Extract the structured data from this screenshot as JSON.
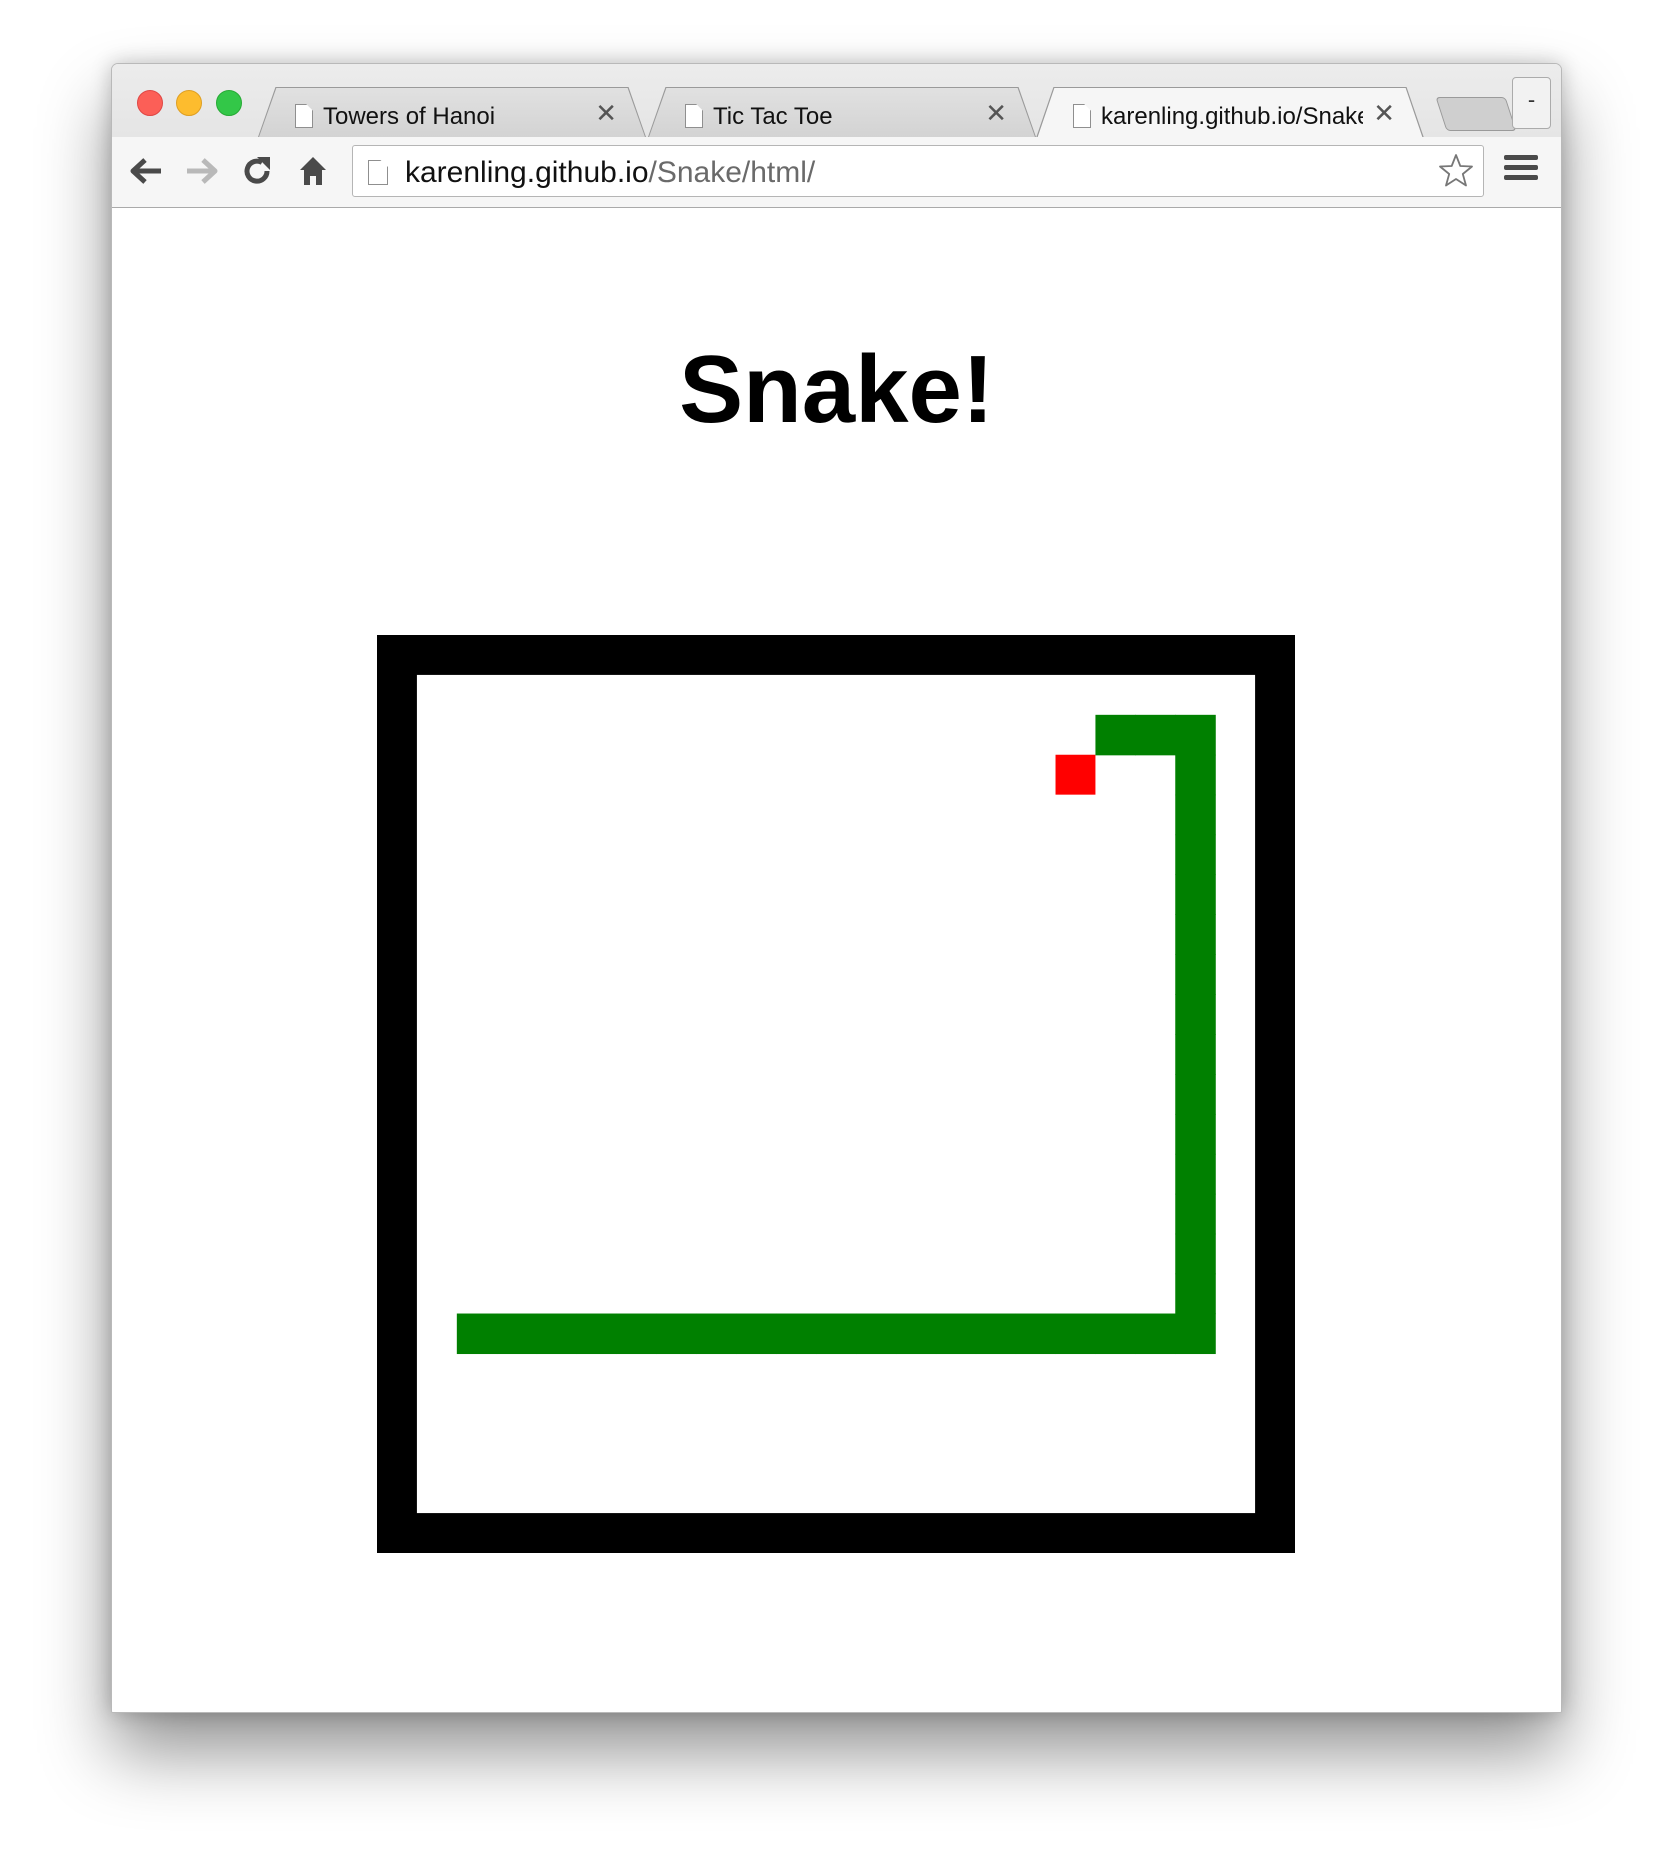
{
  "browser": {
    "tabs": [
      {
        "label": "Towers of Hanoi",
        "active": false
      },
      {
        "label": "Tic Tac Toe",
        "active": false
      },
      {
        "label": "karenling.github.io/Snake/html/",
        "active": true
      }
    ],
    "profile_label": "-",
    "address": {
      "host": "karenling.github.io",
      "path": "/Snake/html/"
    }
  },
  "page": {
    "heading": "Snake!"
  },
  "game": {
    "grid_size": 21,
    "colors": {
      "wall": "#000000",
      "snake": "#008000",
      "apple": "#ff0000",
      "floor": "#ffffff"
    },
    "snake_cells": [
      [
        1,
        16
      ],
      [
        2,
        16
      ],
      [
        3,
        16
      ],
      [
        4,
        16
      ],
      [
        5,
        16
      ],
      [
        6,
        16
      ],
      [
        7,
        16
      ],
      [
        8,
        16
      ],
      [
        9,
        16
      ],
      [
        10,
        16
      ],
      [
        11,
        16
      ],
      [
        12,
        16
      ],
      [
        13,
        16
      ],
      [
        14,
        16
      ],
      [
        15,
        16
      ],
      [
        16,
        16
      ],
      [
        17,
        16
      ],
      [
        18,
        16
      ],
      [
        19,
        16
      ],
      [
        19,
        15
      ],
      [
        19,
        14
      ],
      [
        19,
        13
      ],
      [
        19,
        12
      ],
      [
        19,
        11
      ],
      [
        19,
        10
      ],
      [
        19,
        9
      ],
      [
        19,
        8
      ],
      [
        19,
        7
      ],
      [
        19,
        6
      ],
      [
        19,
        5
      ],
      [
        19,
        4
      ],
      [
        19,
        3
      ],
      [
        19,
        2
      ],
      [
        19,
        1
      ],
      [
        18,
        1
      ],
      [
        17,
        1
      ]
    ],
    "apple_cell": [
      16,
      2
    ]
  }
}
